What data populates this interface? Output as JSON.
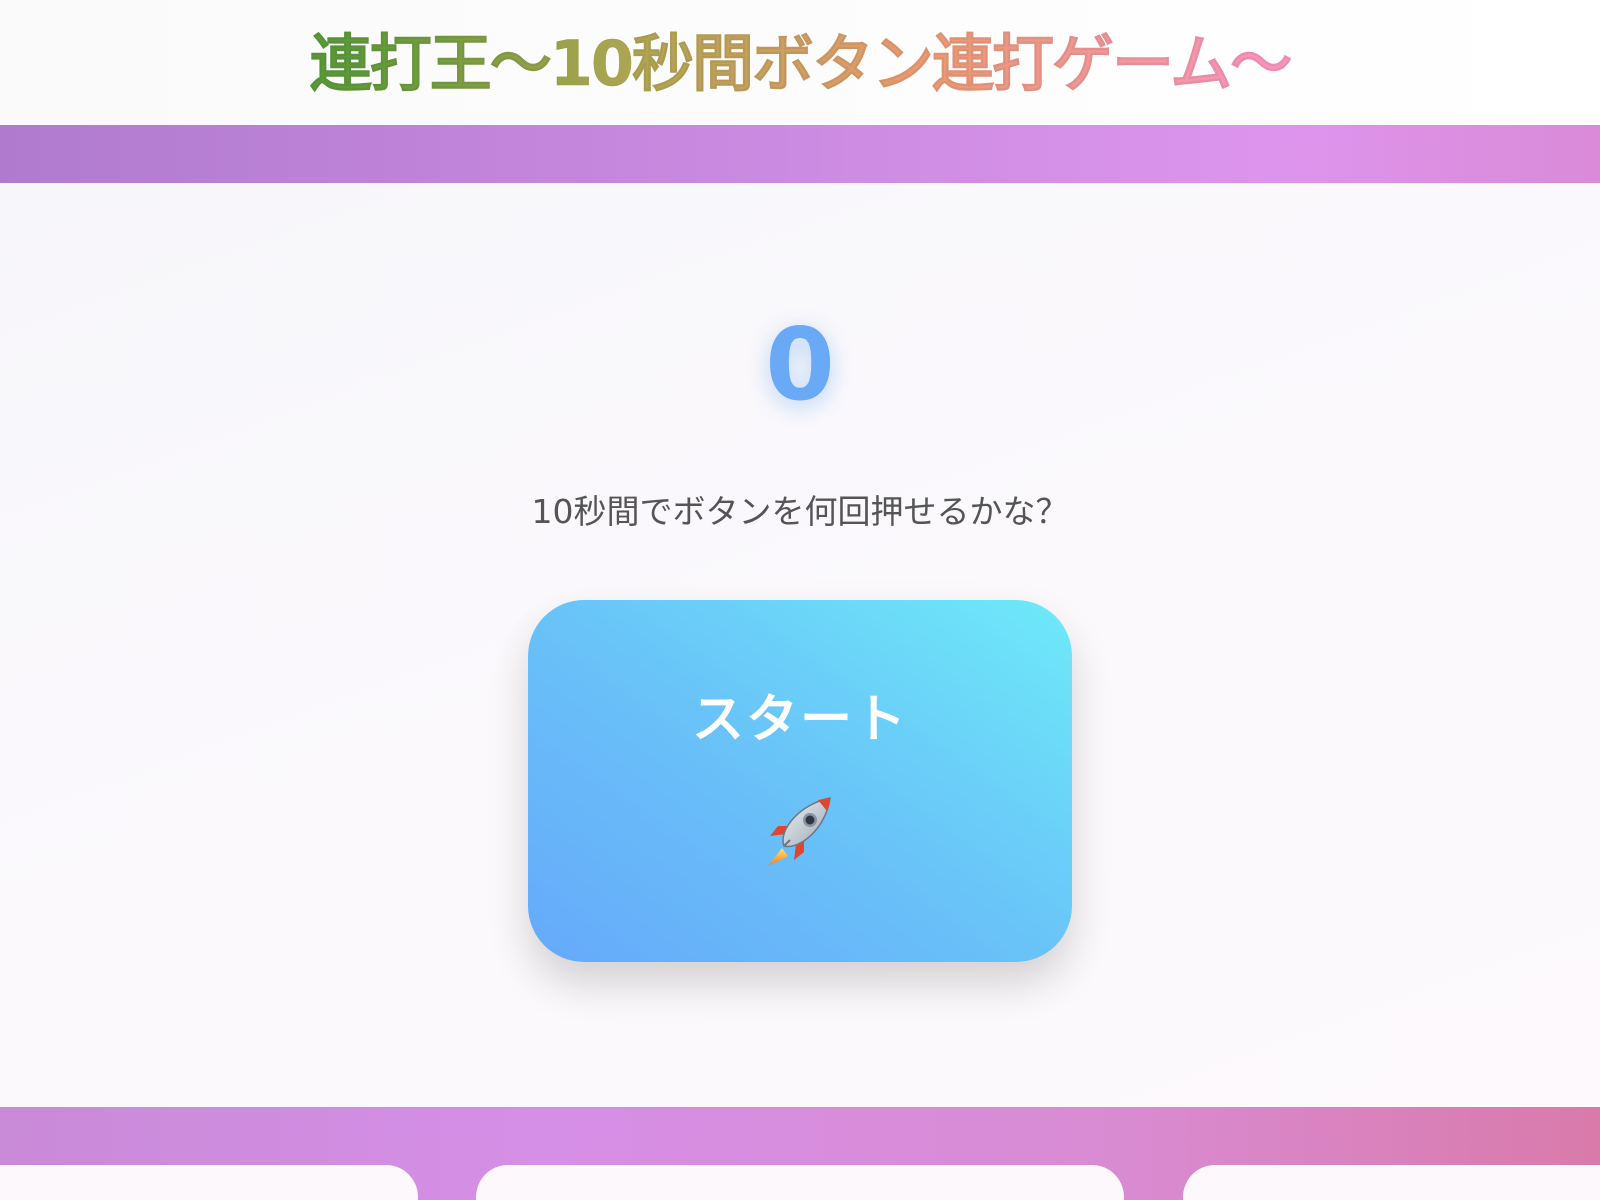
{
  "header": {
    "title": "連打王〜10秒間ボタン連打ゲーム〜"
  },
  "game": {
    "count": "0",
    "instruction": "10秒間でボタンを何回押せるかな？",
    "start_button": {
      "label": "スタート",
      "icon": "rocket-icon"
    }
  },
  "colors": {
    "title_gradient": [
      "#3a9a2e",
      "#b0a552",
      "#e99a72",
      "#ff9fe8"
    ],
    "band": "#c989e0",
    "counter": "#6aa9f6",
    "button_gradient": [
      "#66a9fa",
      "#6eeaf9"
    ],
    "instruction_text": "#555555"
  }
}
